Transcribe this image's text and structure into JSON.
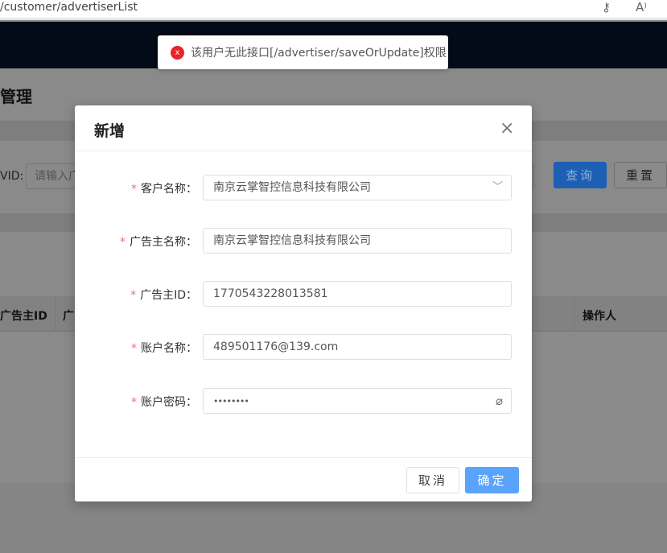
{
  "browser": {
    "url": "/customer/advertiserList",
    "icons": [
      "key-icon",
      "read-aloud-icon"
    ]
  },
  "page": {
    "title": "管理",
    "search_label": "VID:",
    "search_placeholder": "请输入广",
    "query": "查询",
    "reset": "重置",
    "columns": [
      "广告主ID",
      "广",
      "操作人"
    ]
  },
  "toast": {
    "icon": "error-circle-icon",
    "text": "该用户无此接口[/advertiser/saveOrUpdate]权限",
    "color": "#e8232c"
  },
  "modal": {
    "title": "新增",
    "close": "×",
    "fields": [
      {
        "label": "客户名称：",
        "value": "南京云掌智控信息科技有限公司",
        "type": "select"
      },
      {
        "label": "广告主名称：",
        "value": "南京云掌智控信息科技有限公司"
      },
      {
        "label": "广告主ID：",
        "value": "1770543228013581"
      },
      {
        "label": "账户名称：",
        "value": "489501176@139.com"
      },
      {
        "label": "账户密码：",
        "value": "••••••••",
        "type": "password"
      }
    ],
    "required_mark": "*",
    "cancel": "取消",
    "confirm": "确定",
    "accent": "#5aa3fb"
  }
}
